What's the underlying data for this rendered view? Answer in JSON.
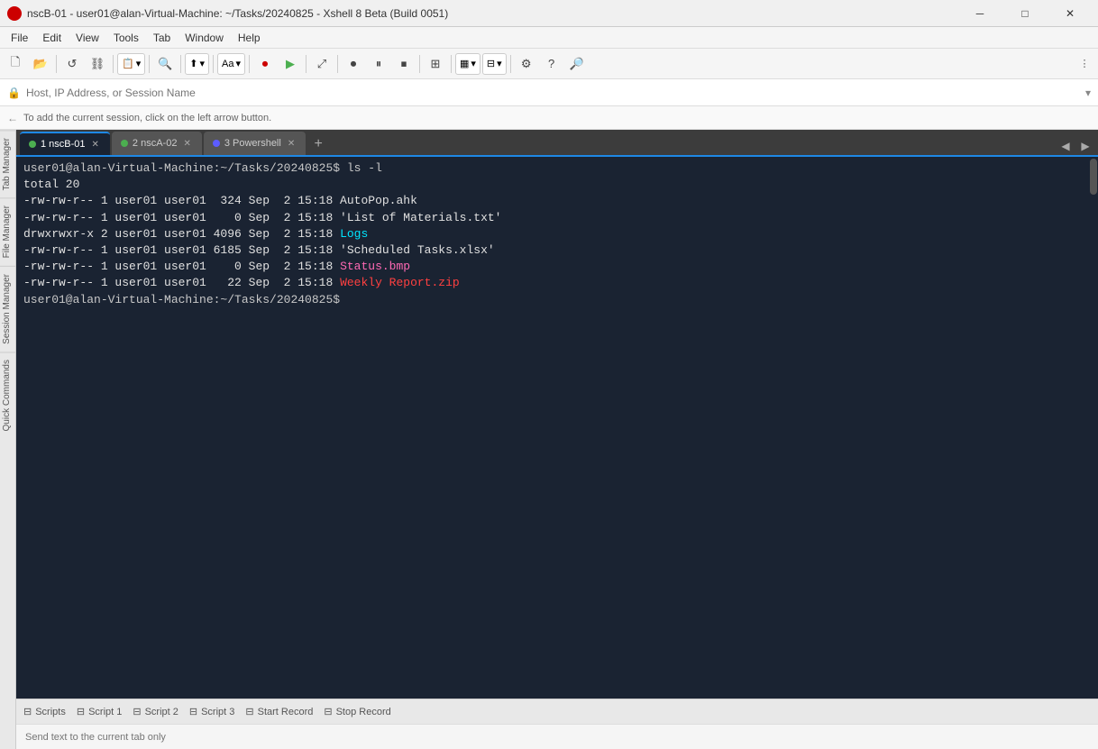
{
  "titlebar": {
    "text": "nscB-01 - user01@alan-Virtual-Machine: ~/Tasks/20240825 - Xshell 8 Beta (Build 0051)",
    "min": "─",
    "max": "□",
    "close": "✕"
  },
  "menubar": {
    "items": [
      "File",
      "Edit",
      "View",
      "Tools",
      "Tab",
      "Window",
      "Help"
    ]
  },
  "addressbar": {
    "placeholder": "Host, IP Address, or Session Name"
  },
  "sessionhint": {
    "text": "To add the current session, click on the left arrow button."
  },
  "tabs": [
    {
      "id": "tab1",
      "label": "1 nscB-01",
      "active": true,
      "dot": "green"
    },
    {
      "id": "tab2",
      "label": "2 nscA-02",
      "active": false,
      "dot": "green"
    },
    {
      "id": "tab3",
      "label": "3 Powershell",
      "active": false,
      "dot": "powershell"
    }
  ],
  "sidebar": {
    "items": [
      "Tab Manager",
      "File Manager",
      "Session Manager",
      "Quick Commands"
    ]
  },
  "terminal": {
    "lines": [
      {
        "type": "prompt",
        "text": "user01@alan-Virtual-Machine:~/Tasks/20240825$ ls -l"
      },
      {
        "type": "plain",
        "text": "total 20"
      },
      {
        "type": "file",
        "perms": "-rw-rw-r--",
        "links": "1",
        "user": "user01",
        "group": "user01",
        "size": " 324",
        "date": "Sep  2 15:18",
        "name": "AutoPop.ahk",
        "color": "white"
      },
      {
        "type": "file",
        "perms": "-rw-rw-r--",
        "links": "1",
        "user": "user01",
        "group": "user01",
        "size": "   0",
        "date": "Sep  2 15:18",
        "name": "'List of Materials.txt'",
        "color": "white"
      },
      {
        "type": "file",
        "perms": "drwxrwxr-x",
        "links": "2",
        "user": "user01",
        "group": "user01",
        "size": "4096",
        "date": "Sep  2 15:18",
        "name": "Logs",
        "color": "cyan"
      },
      {
        "type": "file",
        "perms": "-rw-rw-r--",
        "links": "1",
        "user": "user01",
        "group": "user01",
        "size": "6185",
        "date": "Sep  2 15:18",
        "name": "'Scheduled Tasks.xlsx'",
        "color": "white"
      },
      {
        "type": "file",
        "perms": "-rw-rw-r--",
        "links": "1",
        "user": "user01",
        "group": "user01",
        "size": "   0",
        "date": "Sep  2 15:18",
        "name": "Status.bmp",
        "color": "link"
      },
      {
        "type": "file",
        "perms": "-rw-rw-r--",
        "links": "1",
        "user": "user01",
        "group": "user01",
        "size": "  22",
        "date": "Sep  2 15:18",
        "name": "Weekly Report.zip",
        "color": "red"
      },
      {
        "type": "prompt",
        "text": "user01@alan-Virtual-Machine:~/Tasks/20240825$ "
      }
    ]
  },
  "statusbar": {
    "scripts": "Scripts",
    "script1": "Script 1",
    "script2": "Script 2",
    "script3": "Script 3",
    "startRecord": "Start Record",
    "stopRecord": "Stop Record"
  },
  "sendbar": {
    "placeholder": "Send text to the current tab only"
  }
}
